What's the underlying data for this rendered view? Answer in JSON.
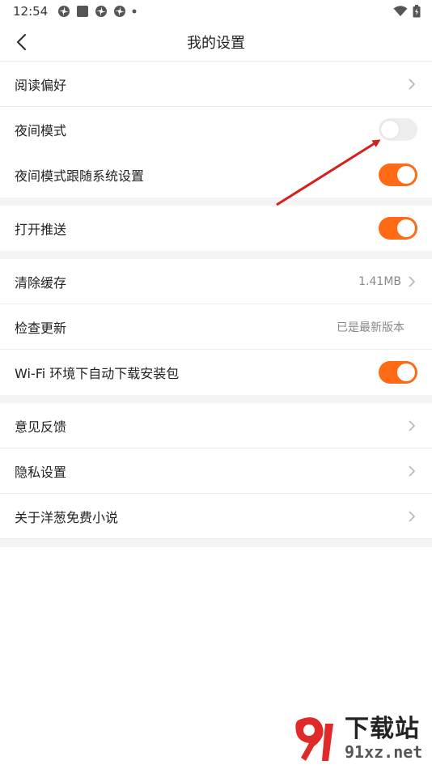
{
  "status_bar": {
    "time": "12:54"
  },
  "header": {
    "title": "我的设置"
  },
  "sections": [
    {
      "rows": [
        {
          "label": "阅读偏好",
          "type": "chevron"
        },
        {
          "label": "夜间模式",
          "type": "toggle",
          "on": false
        },
        {
          "label": "夜间模式跟随系统设置",
          "type": "toggle",
          "on": true
        }
      ]
    },
    {
      "rows": [
        {
          "label": "打开推送",
          "type": "toggle",
          "on": true
        }
      ]
    },
    {
      "rows": [
        {
          "label": "清除缓存",
          "type": "value-chevron",
          "value": "1.41MB"
        },
        {
          "label": "检查更新",
          "type": "value",
          "value": "已是最新版本"
        },
        {
          "label": "Wi-Fi 环境下自动下载安装包",
          "type": "toggle",
          "on": true
        }
      ]
    },
    {
      "rows": [
        {
          "label": "意见反馈",
          "type": "chevron"
        },
        {
          "label": "隐私设置",
          "type": "chevron"
        },
        {
          "label": "关于洋葱免费小说",
          "type": "chevron"
        }
      ]
    }
  ],
  "watermark": {
    "text": "下载站",
    "url": "91xz.net"
  },
  "colors": {
    "accent": "#ff6a16",
    "annotation_arrow": "#d42020"
  },
  "icons": [
    "pinwheel-icon",
    "square-icon",
    "wifi-icon",
    "battery-icon",
    "chevron-left-icon",
    "chevron-right-icon"
  ]
}
